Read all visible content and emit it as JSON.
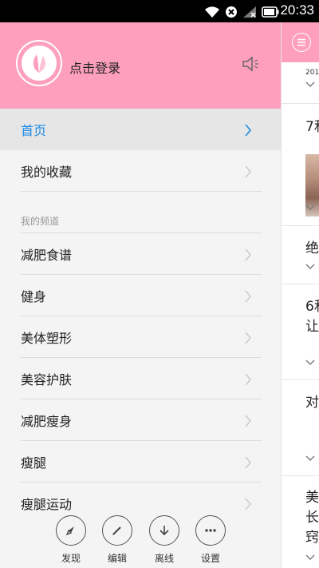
{
  "status_bar": {
    "time": "20:33"
  },
  "drawer": {
    "login_label": "点击登录",
    "items": [
      {
        "label": "首页",
        "active": true
      },
      {
        "label": "我的收藏"
      }
    ],
    "section_title": "我的频道",
    "channels": [
      "减肥食谱",
      "健身",
      "美体塑形",
      "美容护肤",
      "减肥瘦身",
      "瘦腿",
      "瘦腿运动"
    ],
    "bottom_actions": [
      {
        "label": "发现",
        "icon": "compass-icon"
      },
      {
        "label": "编辑",
        "icon": "pencil-icon"
      },
      {
        "label": "离线",
        "icon": "download-icon"
      },
      {
        "label": "设置",
        "icon": "more-dots-icon"
      }
    ]
  },
  "content_peek": {
    "date_fragment": "201",
    "lines": [
      "7和",
      "绝",
      "6和",
      "让",
      "对",
      "美",
      "长",
      "窍"
    ]
  },
  "colors": {
    "header_pink": "#fea0bd",
    "active_blue": "#1e8ae6"
  }
}
